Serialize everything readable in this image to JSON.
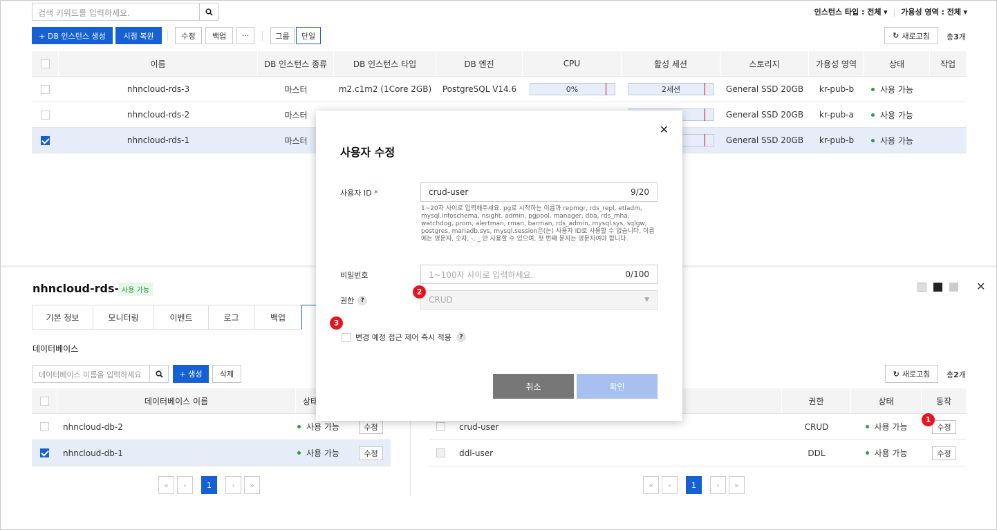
{
  "search": {
    "placeholder": "검색 키워드를 입력하세요."
  },
  "filters": {
    "instance_type": "인스턴스 타입 : 전체",
    "availability": "가용성 영역 : 전체"
  },
  "toolbar": {
    "create": "+ DB 인스턴스 생성",
    "restore": "시점 복원",
    "edit": "수정",
    "backup": "백업",
    "more": "···",
    "group": "그룹",
    "single": "단일",
    "refresh": "새로고침",
    "total_prefix": "총",
    "total_count": "3",
    "total_suffix": "개"
  },
  "instances": {
    "headers": [
      "이름",
      "DB 인스턴스 종류",
      "DB 인스턴스 타입",
      "DB 엔진",
      "CPU",
      "활성 세션",
      "스토리지",
      "가용성 영역",
      "상태",
      "작업"
    ],
    "rows": [
      {
        "name": "nhncloud-rds-3",
        "kind": "마스터",
        "type": "m2.c1m2 (1Core 2GB)",
        "engine": "PostgreSQL V14.6",
        "cpu": "0%",
        "sessions": "2세션",
        "storage": "General SSD 20GB",
        "zone": "kr-pub-b",
        "status": "사용 가능"
      },
      {
        "name": "nhncloud-rds-2",
        "kind": "마스터",
        "storage": "General SSD 20GB",
        "zone": "kr-pub-a",
        "status": "사용 가능"
      },
      {
        "name": "nhncloud-rds-1",
        "kind": "마스터",
        "storage": "General SSD 20GB",
        "zone": "kr-pub-b",
        "status": "사용 가능"
      }
    ]
  },
  "detail": {
    "title": "nhncloud-rds-1",
    "status": "사용 가능",
    "tabs": [
      "기본 정보",
      "모니터링",
      "이벤트",
      "로그",
      "백업"
    ]
  },
  "databases": {
    "section_title": "데이터베이스",
    "search_placeholder": "데이터베이스 이름을 입력하세요",
    "create": "+ 생성",
    "delete": "삭제",
    "col_name": "데이터베이스 이름",
    "col_status": "상태",
    "rows": [
      {
        "name": "nhncloud-db-2",
        "status": "사용 가능",
        "action": "수정"
      },
      {
        "name": "nhncloud-db-1",
        "status": "사용 가능",
        "action": "수정"
      }
    ],
    "page": "1"
  },
  "users": {
    "refresh": "새로고침",
    "total_prefix": "총",
    "total_count": "2",
    "total_suffix": "개",
    "col_perm": "권한",
    "col_status": "상태",
    "col_action": "동작",
    "rows": [
      {
        "name": "crud-user",
        "perm": "CRUD",
        "status": "사용 가능",
        "action": "수정"
      },
      {
        "name": "ddl-user",
        "perm": "DDL",
        "status": "사용 가능",
        "action": "수정"
      }
    ],
    "page": "1"
  },
  "modal": {
    "title": "사용자 수정",
    "user_id_label": "사용자 ID",
    "required": "*",
    "user_id_value": "crud-user",
    "user_id_count": "9/20",
    "user_id_help": "1~20자 사이로 입력해주세요. pg로 시작하는 이름과 repmgr, rds_repl, etladm, mysql.infoschema, nsight, admin, pgpool, manager, dba, rds_mha, watchdog, prom, alertman, rman, barman, rds_admin, mysql.sys, sqlgw, postgres, mariadb.sys, mysql.session은(는) 사용자 ID로 사용할 수 없습니다. 이름에는 영문자, 숫자, -, _ 만 사용할 수 있으며, 첫 번째 문자는 영문자여야 합니다.",
    "password_label": "비밀번호",
    "password_placeholder": "1~100자 사이로 입력하세요.",
    "password_count": "0/100",
    "perm_label": "권한",
    "perm_value": "CRUD",
    "apply_label": "변경 예정 접근 제어 즉시 적용",
    "cancel": "취소",
    "confirm": "확인"
  },
  "badges": [
    "1",
    "2",
    "3"
  ],
  "colors": {
    "primary": "#1560d4",
    "badge": "#e8141c",
    "status": "#2a9d3c"
  }
}
